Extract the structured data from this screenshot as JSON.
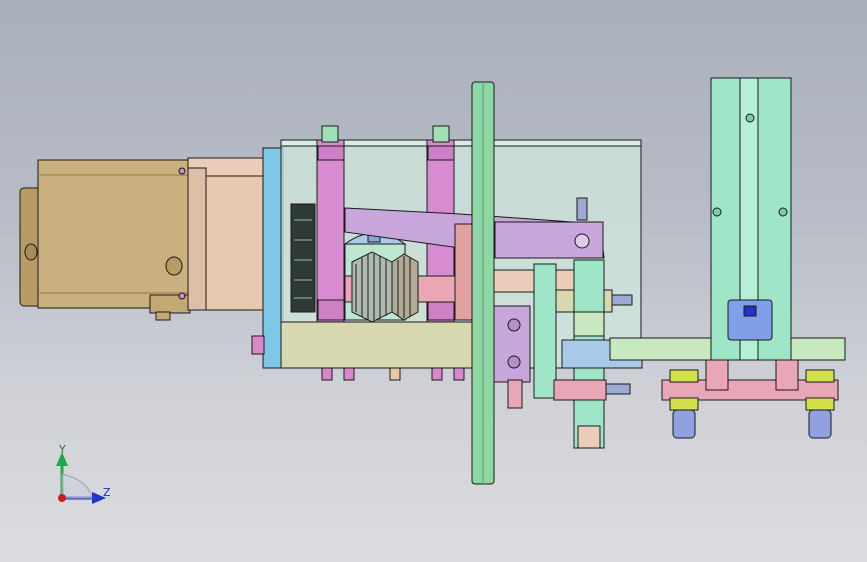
{
  "viewport": {
    "background_top": "#a9b0bc",
    "background_bottom": "#dcdde0"
  },
  "triad": {
    "y_label": "Y",
    "z_label": "Z",
    "y_color": "#1ea64a",
    "z_color": "#2233cc",
    "x_color": "#d21a1a"
  },
  "colors": {
    "motor_body": "#c9b07e",
    "gearbox": "#e6c7b0",
    "flange": "#7fc7e6",
    "housing": "#cfe7dc",
    "rod": "#d88bd0",
    "base_plate": "#d8d8b0",
    "disc": "#8fd6a5",
    "lever": "#c8a6dc",
    "slide_rail": "#9fe6c9",
    "cam_block": "#7f9fe6",
    "bracket": "#e8a6b6",
    "nut_yellow": "#d4e04a",
    "nut_blue": "#8f9fe0"
  }
}
